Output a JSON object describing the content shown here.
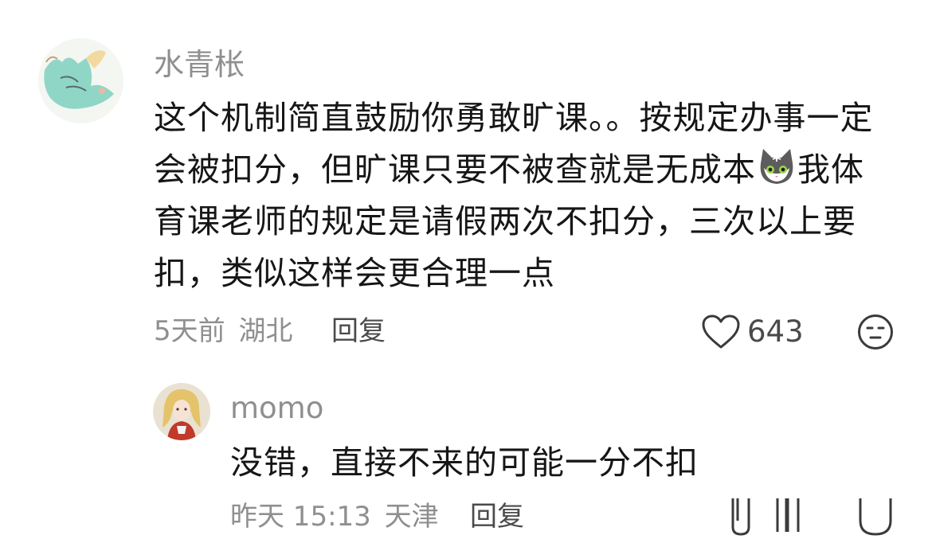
{
  "comment": {
    "author": "水青枨",
    "text_part1": "这个机制简直鼓励你勇敢旷课。。按规定办事一定会被扣分，但旷课只要不被查就是无成本",
    "text_part2": "我体育课老师的规定是请假两次不扣分，三次以上要扣，类似这样会更合理一点",
    "emoji": "cat-emoji-icon",
    "time": "5天前",
    "location": "湖北",
    "reply_label": "回复",
    "like_count": "643"
  },
  "reply": {
    "author": "momo",
    "text": "没错，直接不来的可能一分不扣",
    "time": "昨天 15:13",
    "location": "天津",
    "reply_label": "回复"
  },
  "colors": {
    "meta_text": "#8f8f8f",
    "body_text": "#161616",
    "icon": "#3a3a3a"
  }
}
